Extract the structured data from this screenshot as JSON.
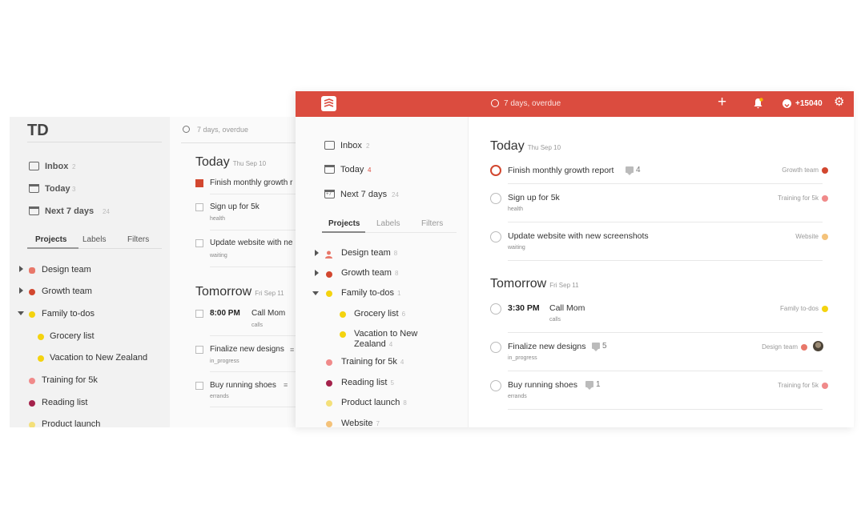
{
  "back_window": {
    "logo": "TD",
    "search_placeholder": "7 days, overdue",
    "nav": [
      {
        "label": "Inbox",
        "count": "2"
      },
      {
        "label": "Today",
        "count": "3"
      },
      {
        "label": "Next 7 days",
        "count": "24"
      }
    ],
    "tabs": [
      "Projects",
      "Labels",
      "Filters"
    ],
    "projects": [
      {
        "label": "Design team",
        "count": "8",
        "color": "#e8786a"
      },
      {
        "label": "Growth team",
        "count": "8",
        "color": "#d2472f"
      },
      {
        "label": "Family to-dos",
        "count": "1",
        "color": "#f4d30f"
      },
      {
        "label": "Grocery list",
        "count": "6",
        "color": "#f4d30f"
      },
      {
        "label": "Vacation to New Zealand",
        "count": "4",
        "color": "#f4d30f"
      },
      {
        "label": "Training for 5k",
        "count": "4",
        "color": "#f08a8a"
      },
      {
        "label": "Reading list",
        "count": "5",
        "color": "#a4224b"
      },
      {
        "label": "Product launch",
        "count": "8",
        "color": "#f4e07a"
      }
    ],
    "today_heading": "Today",
    "today_date": "Thu Sep 10",
    "today_tasks": [
      {
        "title": "Finish monthly growth r",
        "label": ""
      },
      {
        "title": "Sign up for 5k",
        "label": "health"
      },
      {
        "title": "Update website with ne",
        "label": "waiting"
      }
    ],
    "tomorrow_heading": "Tomorrow",
    "tomorrow_date": "Fri Sep 11",
    "tomorrow_tasks": [
      {
        "time": "8:00 PM",
        "title": "Call Mom",
        "label": "calls"
      },
      {
        "title": "Finalize new designs",
        "label": "in_progress"
      },
      {
        "title": "Buy running shoes",
        "label": "errands"
      }
    ]
  },
  "front_window": {
    "search_placeholder": "7 days, overdue",
    "karma": "+15040",
    "nav": [
      {
        "label": "Inbox",
        "count": "2"
      },
      {
        "label": "Today",
        "count": "4"
      },
      {
        "label": "Next 7 days",
        "count": "24"
      }
    ],
    "tabs": [
      "Projects",
      "Labels",
      "Filters"
    ],
    "projects": [
      {
        "label": "Design team",
        "count": "8",
        "color": "#e8786a"
      },
      {
        "label": "Growth team",
        "count": "8",
        "color": "#d2472f"
      },
      {
        "label": "Family to-dos",
        "count": "1",
        "color": "#f4d30f"
      },
      {
        "label": "Grocery list",
        "count": "6",
        "color": "#f4d30f"
      },
      {
        "label": "Vacation to New",
        "label2": "Zealand",
        "count": "4",
        "color": "#f4d30f"
      },
      {
        "label": "Training for 5k",
        "count": "4",
        "color": "#f08a8a"
      },
      {
        "label": "Reading list",
        "count": "5",
        "color": "#a4224b"
      },
      {
        "label": "Product launch",
        "count": "8",
        "color": "#f4e07a"
      },
      {
        "label": "Website",
        "count": "7",
        "color": "#f4c27a"
      }
    ],
    "today_heading": "Today",
    "today_date": "Thu Sep 10",
    "today_tasks": [
      {
        "title": "Finish monthly growth report",
        "comments": "4",
        "project": "Growth team",
        "project_color": "#d2472f",
        "label": ""
      },
      {
        "title": "Sign up for 5k",
        "comments": "",
        "project": "Training for 5k",
        "project_color": "#f08a8a",
        "label": "health"
      },
      {
        "title": "Update website with new screenshots",
        "comments": "",
        "project": "Website",
        "project_color": "#f4c27a",
        "label": "waiting"
      }
    ],
    "tomorrow_heading": "Tomorrow",
    "tomorrow_date": "Fri Sep 11",
    "tomorrow_tasks": [
      {
        "time": "3:30 PM",
        "title": "Call Mom",
        "comments": "",
        "project": "Family to-dos",
        "project_color": "#f4d30f",
        "label": "calls"
      },
      {
        "title": "Finalize new designs",
        "comments": "5",
        "project": "Design team",
        "project_color": "#e8786a",
        "label": "in_progress"
      },
      {
        "title": "Buy running shoes",
        "comments": "1",
        "project": "Training for 5k",
        "project_color": "#f08a8a",
        "label": "errands"
      }
    ]
  }
}
